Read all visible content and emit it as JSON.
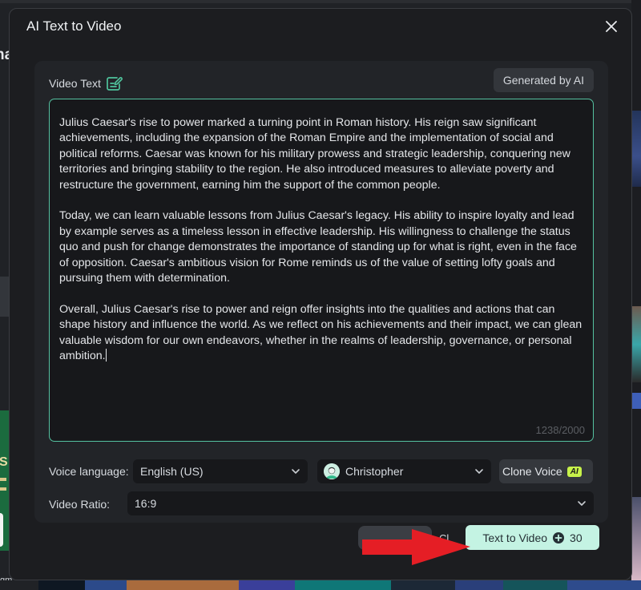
{
  "dialog": {
    "title": "AI Text to Video",
    "close_icon": "close-icon"
  },
  "video_text": {
    "label": "Video Text",
    "label_icon": "edit-note-icon",
    "generated_button": "Generated by AI",
    "paragraphs": [
      "Julius Caesar's rise to power marked a turning point in Roman history. His reign saw significant achievements, including the expansion of the Roman Empire and the implementation of social and political reforms. Caesar was known for his military prowess and strategic leadership, conquering new territories and bringing stability to the region. He also introduced measures to alleviate poverty and restructure the government, earning him the support of the common people.",
      "Today, we can learn valuable lessons from Julius Caesar's legacy. His ability to inspire loyalty and lead by example serves as a timeless lesson in effective leadership. His willingness to challenge the status quo and push for change demonstrates the importance of standing up for what is right, even in the face of opposition. Caesar's ambitious vision for Rome reminds us of the value of setting lofty goals and pursuing them with determination.",
      "Overall, Julius Caesar's rise to power and reign offer insights into the qualities and actions that can shape history and influence the world. As we reflect on his achievements and their impact, we can glean valuable wisdom for our own endeavors, whether in the realms of leadership, governance, or personal ambition."
    ],
    "char_count": "1238/2000"
  },
  "voice": {
    "label": "Voice language:",
    "language_value": "English (US)",
    "voice_value": "Christopher",
    "voice_icon": "avatar-icon",
    "clone_button": "Clone Voice",
    "clone_badge": "AI"
  },
  "ratio": {
    "label": "Video Ratio:",
    "value": "16:9"
  },
  "footer": {
    "cancel_label_partial": "Çl",
    "primary_button": "Text to Video",
    "credit_icon": "credit-plus-icon",
    "credit_cost": "30"
  },
  "annotation": {
    "arrow": "red-arrow-pointing-right",
    "color": "#e51e25"
  },
  "colors": {
    "accent": "#55c1a0",
    "primary_button_bg": "#c4f3e3",
    "ai_badge": "#c7f24a"
  },
  "background": {
    "left_text": "na",
    "left_banner_letter": "S",
    "left_caption": "gm......"
  }
}
